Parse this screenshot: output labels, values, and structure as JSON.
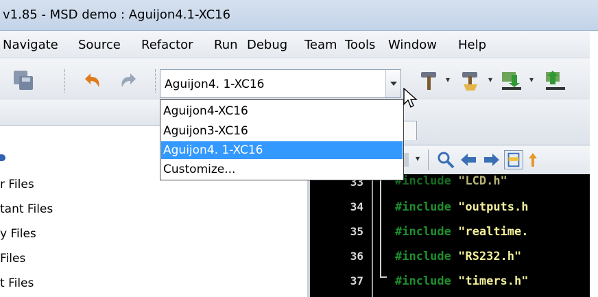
{
  "window": {
    "title": "v1.85 - MSD demo : Aguijon4.1-XC16"
  },
  "menu": {
    "items": [
      "Navigate",
      "Source",
      "Refactor",
      "Run",
      "Debug",
      "Team",
      "Tools",
      "Window",
      "Help"
    ]
  },
  "toolbar": {
    "config_combo": {
      "value": "Aguijon4. 1-XC16",
      "options": [
        {
          "label": "Aguijon4-XC16",
          "selected": false
        },
        {
          "label": "Aguijon3-XC16",
          "selected": false
        },
        {
          "label": "Aguijon4. 1-XC16",
          "selected": true
        },
        {
          "label": "Customize...",
          "selected": false
        }
      ]
    }
  },
  "project_tree": {
    "items": [
      "r Files",
      "tant Files",
      "y Files",
      "Files",
      "t Files"
    ]
  },
  "editor": {
    "lines": [
      {
        "num": "33",
        "directive": "#include",
        "file": "\"LCD.h\""
      },
      {
        "num": "34",
        "directive": "#include",
        "file": "\"outputs.h"
      },
      {
        "num": "35",
        "directive": "#include",
        "file": "\"realtime."
      },
      {
        "num": "36",
        "directive": "#include",
        "file": "\"RS232.h\""
      },
      {
        "num": "37",
        "directive": "#include",
        "file": "\"timers.h\""
      }
    ]
  },
  "colors": {
    "selection": "#3399ff",
    "code_bg": "#000000",
    "keyword": "#1e8f2c",
    "string": "#f3ef9c"
  }
}
